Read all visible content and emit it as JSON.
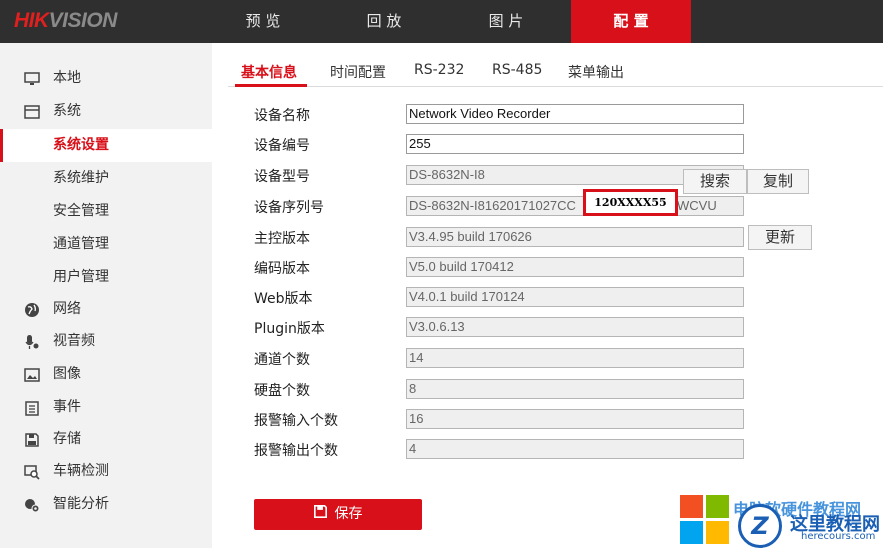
{
  "brand": {
    "logo_red": "HIK",
    "logo_grey": "VISION"
  },
  "topnav": [
    {
      "label": "预 览"
    },
    {
      "label": "回 放"
    },
    {
      "label": "图 片"
    },
    {
      "label": "配 置",
      "active": true
    }
  ],
  "sidebar": [
    {
      "label": "本地",
      "icon": "monitor-icon"
    },
    {
      "label": "系统",
      "icon": "system-icon"
    },
    {
      "label": "系统设置",
      "active": true
    },
    {
      "label": "系统维护"
    },
    {
      "label": "安全管理"
    },
    {
      "label": "通道管理"
    },
    {
      "label": "用户管理"
    },
    {
      "label": "网络",
      "icon": "globe-icon"
    },
    {
      "label": "视音频",
      "icon": "microphone-icon"
    },
    {
      "label": "图像",
      "icon": "image-icon"
    },
    {
      "label": "事件",
      "icon": "calendar-icon"
    },
    {
      "label": "存储",
      "icon": "save-icon"
    },
    {
      "label": "车辆检测",
      "icon": "vehicle-search-icon"
    },
    {
      "label": "智能分析",
      "icon": "smart-analysis-icon"
    }
  ],
  "tabs": [
    {
      "label": "基本信息",
      "active": true
    },
    {
      "label": "时间配置"
    },
    {
      "label": "RS-232"
    },
    {
      "label": "RS-485"
    },
    {
      "label": "菜单输出"
    }
  ],
  "form": [
    {
      "label": "设备名称",
      "value": "Network Video Recorder",
      "editable": true
    },
    {
      "label": "设备编号",
      "value": "255",
      "editable": true
    },
    {
      "label": "设备型号",
      "value": "DS-8632N-I8"
    },
    {
      "label": "设备序列号",
      "value": "DS-8632N-I81620171027CC",
      "value_tail": "WCVU"
    },
    {
      "label": "主控版本",
      "value": "V3.4.95 build 170626"
    },
    {
      "label": "编码版本",
      "value": "V5.0 build 170412"
    },
    {
      "label": "Web版本",
      "value": "V4.0.1 build 170124"
    },
    {
      "label": "Plugin版本",
      "value": "V3.0.6.13"
    },
    {
      "label": "通道个数",
      "value": "14"
    },
    {
      "label": "硬盘个数",
      "value": "8"
    },
    {
      "label": "报警输入个数",
      "value": "16"
    },
    {
      "label": "报警输出个数",
      "value": "4"
    }
  ],
  "buttons": {
    "search": "搜索",
    "copy": "复制",
    "update": "更新",
    "save": "保存"
  },
  "redacted_overlay": "120XXXX55",
  "watermark": {
    "line1": "电脑软硬件教程网",
    "line2": "这里教程网",
    "line3": "herecours.com",
    "badge": "Z"
  },
  "colors": {
    "accent": "#d8101a",
    "topbar": "#2f2f2f",
    "sidebar": "#f2f2f2"
  }
}
